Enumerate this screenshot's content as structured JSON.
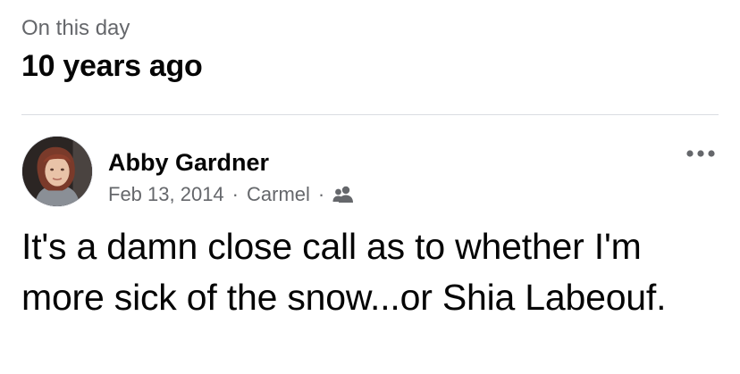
{
  "memory": {
    "label": "On this day",
    "title": "10 years ago"
  },
  "post": {
    "author": "Abby Gardner",
    "date": "Feb 13, 2014",
    "separator": "·",
    "location": "Carmel",
    "audience_icon": "friends-icon",
    "more_icon": "more-options-icon",
    "text": "It's a damn close call as to whether I'm more sick of the snow...or Shia Labeouf."
  },
  "colors": {
    "primary_text": "#050505",
    "secondary_text": "#65676b",
    "divider": "#dadde1"
  }
}
